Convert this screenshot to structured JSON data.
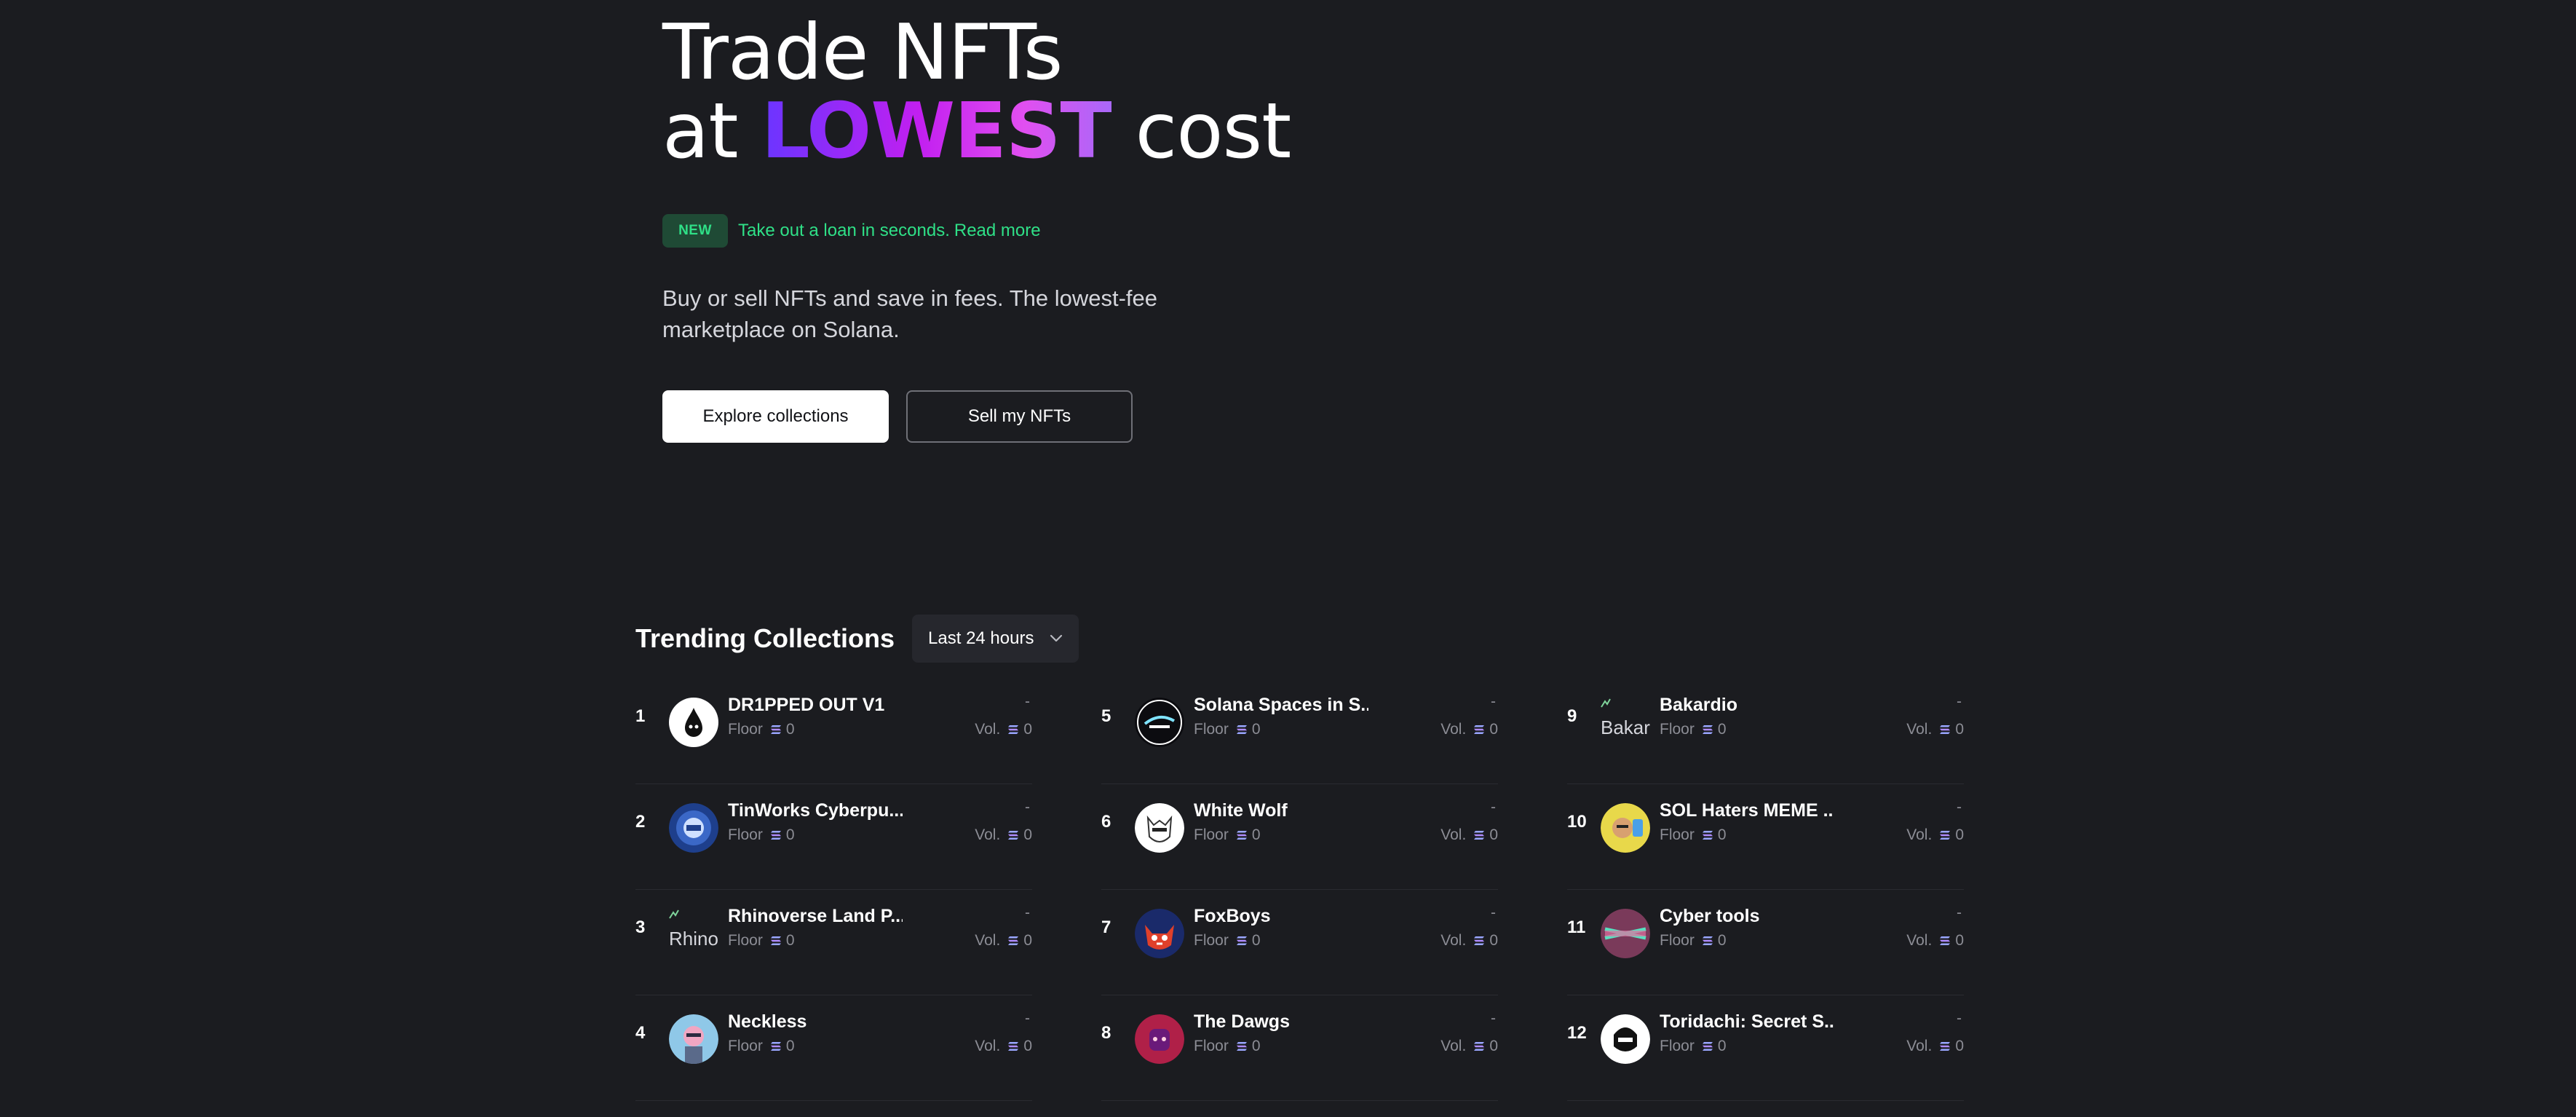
{
  "hero": {
    "title_line1": "Trade NFTs",
    "title_line2_pre": "at ",
    "title_accent": "LOWEST",
    "title_line2_post": " cost",
    "new_badge": "NEW",
    "announcement": "Take out a loan in seconds.",
    "announcement_link": "Read more",
    "description": "Buy or sell NFTs and save in fees. The lowest-fee marketplace on Solana.",
    "primary_button": "Explore collections",
    "secondary_button": "Sell my NFTs"
  },
  "trending": {
    "title": "Trending Collections",
    "period": "Last 24 hours",
    "floor_label": "Floor",
    "vol_label": "Vol.",
    "collections": [
      {
        "rank": "1",
        "name": "DR1PPED OUT V1",
        "floor": "0",
        "vol": "0",
        "change": "-"
      },
      {
        "rank": "2",
        "name": "TinWorks Cyberpu...",
        "floor": "0",
        "vol": "0",
        "change": "-"
      },
      {
        "rank": "3",
        "name": "Rhinoverse Land P...",
        "floor": "0",
        "vol": "0",
        "change": "-",
        "avatar_alt": "Rhinov"
      },
      {
        "rank": "4",
        "name": "Neckless",
        "floor": "0",
        "vol": "0",
        "change": "-"
      },
      {
        "rank": "5",
        "name": "Solana Spaces in S...",
        "floor": "0",
        "vol": "0",
        "change": "-"
      },
      {
        "rank": "6",
        "name": "White Wolf",
        "floor": "0",
        "vol": "0",
        "change": "-"
      },
      {
        "rank": "7",
        "name": "FoxBoys",
        "floor": "0",
        "vol": "0",
        "change": "-"
      },
      {
        "rank": "8",
        "name": "The Dawgs",
        "floor": "0",
        "vol": "0",
        "change": "-"
      },
      {
        "rank": "9",
        "name": "Bakardio",
        "floor": "0",
        "vol": "0",
        "change": "-",
        "avatar_alt": "Bakard"
      },
      {
        "rank": "10",
        "name": "SOL Haters MEME ...",
        "floor": "0",
        "vol": "0",
        "change": "-"
      },
      {
        "rank": "11",
        "name": "Cyber tools",
        "floor": "0",
        "vol": "0",
        "change": "-"
      },
      {
        "rank": "12",
        "name": "Toridachi: Secret S...",
        "floor": "0",
        "vol": "0",
        "change": "-"
      }
    ]
  },
  "colors": {
    "background": "#1b1c20",
    "accent_green": "#2fe087",
    "gradient_start": "#6a35ff",
    "gradient_mid": "#c21ff0",
    "gradient_end": "#a968f8"
  },
  "icons": {
    "currency": "solana-icon",
    "dropdown": "chevron-down-icon"
  }
}
